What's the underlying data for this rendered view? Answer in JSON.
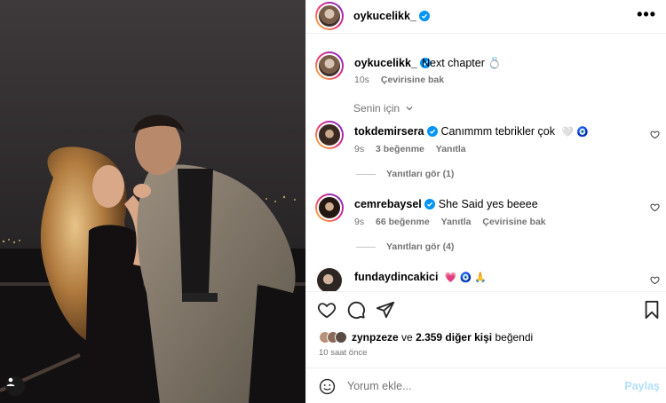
{
  "header": {
    "username": "oykucelikk_",
    "more_label": "•••"
  },
  "caption": {
    "username": "oykucelikk_",
    "text": "Next chapter",
    "emoji": "💍",
    "time": "10s",
    "translate": "Çevirisine bak"
  },
  "filter": {
    "label": "Senin için",
    "chevron": "chevron-down-icon"
  },
  "comments": [
    {
      "username": "tokdemirsera",
      "verified": true,
      "text": "Canımmm tebrikler çok",
      "emojis": "🤍 🧿",
      "time": "9s",
      "likes": "3 beğenme",
      "reply": "Yanıtla",
      "translate": "",
      "view_replies": "Yanıtları gör (1)"
    },
    {
      "username": "cemrebaysel",
      "verified": true,
      "text": "She Said yes beeee",
      "emojis": "",
      "time": "9s",
      "likes": "66 beğenme",
      "reply": "Yanıtla",
      "translate": "Çevirisine bak",
      "view_replies": "Yanıtları gör (4)"
    },
    {
      "username": "fundaydincakici",
      "verified": false,
      "text": "",
      "emojis": "💗 🧿 🙏",
      "time": "",
      "likes": "",
      "reply": "",
      "translate": "",
      "view_replies": ""
    }
  ],
  "actions": {
    "like": "heart-icon",
    "comment": "comment-icon",
    "share": "share-icon",
    "save": "bookmark-icon"
  },
  "likes": {
    "first_user": "zynpzeze",
    "connector": "ve",
    "others": "2.359 diğer kişi",
    "suffix": "beğendi"
  },
  "post_time": "10 saat önce",
  "composer": {
    "placeholder": "Yorum ekle...",
    "post_label": "Paylaş"
  },
  "colors": {
    "verified": "#0095f6",
    "muted": "#737373",
    "post_disabled": "#b2dffc"
  }
}
